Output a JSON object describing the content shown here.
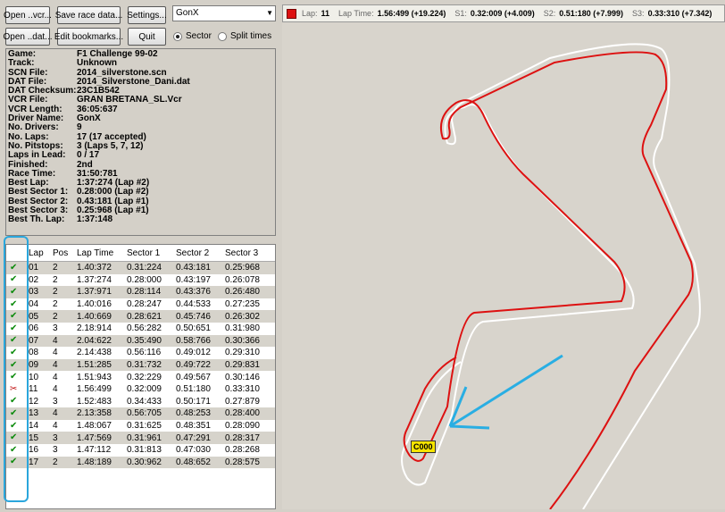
{
  "toolbar": {
    "open_vcr": "Open ..vcr...",
    "save_race_data": "Save race data...",
    "settings": "Settings...",
    "open_dat": "Open ..dat...",
    "edit_bookmarks": "Edit bookmarks...",
    "quit": "Quit",
    "driver_select": "GonX",
    "radio_sector": "Sector",
    "radio_split": "Split times"
  },
  "info": [
    {
      "k": "Game:",
      "v": "F1 Challenge 99-02"
    },
    {
      "k": "Track:",
      "v": "Unknown"
    },
    {
      "k": "SCN File:",
      "v": "2014_silverstone.scn"
    },
    {
      "k": "DAT File:",
      "v": "2014_Silverstone_Dani.dat"
    },
    {
      "k": "DAT Checksum:",
      "v": "23C1B542"
    },
    {
      "k": "VCR File:",
      "v": "GRAN BRETANA_SL.Vcr"
    },
    {
      "k": "VCR Length:",
      "v": "36:05:637"
    },
    {
      "k": "Driver Name:",
      "v": "GonX"
    },
    {
      "k": "No. Drivers:",
      "v": "9"
    },
    {
      "k": "No. Laps:",
      "v": "17 (17 accepted)"
    },
    {
      "k": "No. Pitstops:",
      "v": "3 (Laps 5, 7, 12)"
    },
    {
      "k": "Laps in Lead:",
      "v": "0 / 17"
    },
    {
      "k": "Finished:",
      "v": "2nd"
    },
    {
      "k": "Race Time:",
      "v": "31:50:781"
    },
    {
      "k": "Best Lap:",
      "v": "1:37:274 (Lap #2)"
    },
    {
      "k": "Best Sector 1:",
      "v": "0.28:000 (Lap #2)"
    },
    {
      "k": "Best Sector 2:",
      "v": "0.43:181 (Lap #1)"
    },
    {
      "k": "Best Sector 3:",
      "v": "0.25:968 (Lap #1)"
    },
    {
      "k": "Best Th. Lap:",
      "v": "1:37:148"
    }
  ],
  "lap_table": {
    "headers": [
      "",
      "Lap",
      "Pos",
      "Lap Time",
      "Sector 1",
      "Sector 2",
      "Sector 3"
    ],
    "rows": [
      {
        "mark": "ok",
        "lap": "01",
        "pos": "2",
        "time": "1.40:372",
        "s1": "0.31:224",
        "s2": "0.43:181",
        "s3": "0.25:968"
      },
      {
        "mark": "ok",
        "lap": "02",
        "pos": "2",
        "time": "1.37:274",
        "s1": "0.28:000",
        "s2": "0.43:197",
        "s3": "0.26:078"
      },
      {
        "mark": "ok",
        "lap": "03",
        "pos": "2",
        "time": "1.37:971",
        "s1": "0.28:114",
        "s2": "0.43:376",
        "s3": "0.26:480"
      },
      {
        "mark": "ok",
        "lap": "04",
        "pos": "2",
        "time": "1.40:016",
        "s1": "0.28:247",
        "s2": "0.44:533",
        "s3": "0.27:235"
      },
      {
        "mark": "ok",
        "lap": "05",
        "pos": "2",
        "time": "1.40:669",
        "s1": "0.28:621",
        "s2": "0.45:746",
        "s3": "0.26:302"
      },
      {
        "mark": "ok",
        "lap": "06",
        "pos": "3",
        "time": "2.18:914",
        "s1": "0.56:282",
        "s2": "0.50:651",
        "s3": "0.31:980"
      },
      {
        "mark": "ok",
        "lap": "07",
        "pos": "4",
        "time": "2.04:622",
        "s1": "0.35:490",
        "s2": "0.58:766",
        "s3": "0.30:366"
      },
      {
        "mark": "ok",
        "lap": "08",
        "pos": "4",
        "time": "2.14:438",
        "s1": "0.56:116",
        "s2": "0.49:012",
        "s3": "0.29:310"
      },
      {
        "mark": "ok",
        "lap": "09",
        "pos": "4",
        "time": "1.51:285",
        "s1": "0.31:732",
        "s2": "0.49:722",
        "s3": "0.29:831"
      },
      {
        "mark": "ok",
        "lap": "10",
        "pos": "4",
        "time": "1.51:943",
        "s1": "0.32:229",
        "s2": "0.49:567",
        "s3": "0.30:146"
      },
      {
        "mark": "bad",
        "lap": "11",
        "pos": "4",
        "time": "1.56:499",
        "s1": "0.32:009",
        "s2": "0.51:180",
        "s3": "0.33:310"
      },
      {
        "mark": "ok",
        "lap": "12",
        "pos": "3",
        "time": "1.52:483",
        "s1": "0.34:433",
        "s2": "0.50:171",
        "s3": "0.27:879"
      },
      {
        "mark": "ok",
        "lap": "13",
        "pos": "4",
        "time": "2.13:358",
        "s1": "0.56:705",
        "s2": "0.48:253",
        "s3": "0.28:400"
      },
      {
        "mark": "ok",
        "lap": "14",
        "pos": "4",
        "time": "1.48:067",
        "s1": "0.31:625",
        "s2": "0.48:351",
        "s3": "0.28:090"
      },
      {
        "mark": "ok",
        "lap": "15",
        "pos": "3",
        "time": "1.47:569",
        "s1": "0.31:961",
        "s2": "0.47:291",
        "s3": "0.28:317"
      },
      {
        "mark": "ok",
        "lap": "16",
        "pos": "3",
        "time": "1.47:112",
        "s1": "0.31:813",
        "s2": "0.47:030",
        "s3": "0.28:268"
      },
      {
        "mark": "ok",
        "lap": "17",
        "pos": "2",
        "time": "1.48:189",
        "s1": "0.30:962",
        "s2": "0.48:652",
        "s3": "0.28:575"
      }
    ]
  },
  "status": {
    "lap_label": "Lap:",
    "lap": "11",
    "lap_time_label": "Lap Time:",
    "lap_time": "1.56:499 (+19.224)",
    "s1_label": "S1:",
    "s1": "0.32:009 (+4.009)",
    "s2_label": "S2:",
    "s2": "0.51:180 (+7.999)",
    "s3_label": "S3:",
    "s3": "0.33:310 (+7.342)"
  },
  "map": {
    "marker_label": "C000",
    "line_color": "#dd1111",
    "arrow_color": "#29aee3"
  }
}
